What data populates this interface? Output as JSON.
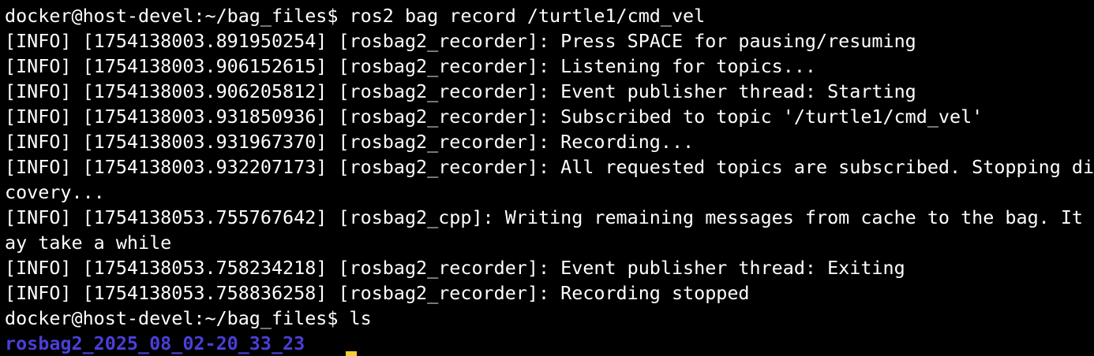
{
  "terminal": {
    "lines": [
      "docker@host-devel:~/bag_files$ ros2 bag record /turtle1/cmd_vel",
      "[INFO] [1754138003.891950254] [rosbag2_recorder]: Press SPACE for pausing/resuming",
      "[INFO] [1754138003.906152615] [rosbag2_recorder]: Listening for topics...",
      "[INFO] [1754138003.906205812] [rosbag2_recorder]: Event publisher thread: Starting",
      "[INFO] [1754138003.931850936] [rosbag2_recorder]: Subscribed to topic '/turtle1/cmd_vel'",
      "[INFO] [1754138003.931967370] [rosbag2_recorder]: Recording...",
      "[INFO] [1754138003.932207173] [rosbag2_recorder]: All requested topics are subscribed. Stopping dis",
      "covery...",
      "[INFO] [1754138053.755767642] [rosbag2_cpp]: Writing remaining messages from cache to the bag. It m",
      "ay take a while",
      "[INFO] [1754138053.758234218] [rosbag2_recorder]: Event publisher thread: Exiting",
      "[INFO] [1754138053.758836258] [rosbag2_recorder]: Recording stopped",
      "docker@host-devel:~/bag_files$ ls"
    ],
    "listing": "rosbag2_2025_08_02-20_33_23",
    "colors": {
      "background": "#000000",
      "text": "#ffffff",
      "directory": "#4a3fd8",
      "cursor": "#f3cf2f"
    }
  }
}
